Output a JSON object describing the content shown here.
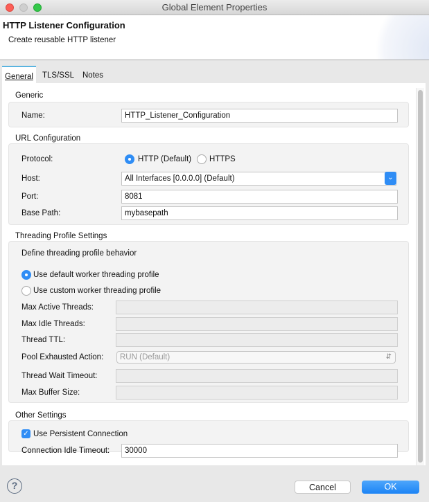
{
  "window": {
    "title": "Global Element Properties"
  },
  "header": {
    "title": "HTTP Listener Configuration",
    "subtitle": "Create reusable HTTP listener"
  },
  "tabs": [
    {
      "label": "General",
      "active": true
    },
    {
      "label": "TLS/SSL"
    },
    {
      "label": "Notes"
    }
  ],
  "generic": {
    "title": "Generic",
    "name_label": "Name:",
    "name_value": "HTTP_Listener_Configuration"
  },
  "url": {
    "title": "URL Configuration",
    "protocol_label": "Protocol:",
    "protocol_options": [
      "HTTP (Default)",
      "HTTPS"
    ],
    "protocol_selected": "HTTP (Default)",
    "host_label": "Host:",
    "host_value": "All Interfaces [0.0.0.0] (Default)",
    "port_label": "Port:",
    "port_value": "8081",
    "basepath_label": "Base Path:",
    "basepath_value": "mybasepath"
  },
  "threading": {
    "title": "Threading Profile Settings",
    "description": "Define threading profile behavior",
    "option_default": "Use default worker threading profile",
    "option_custom": "Use custom worker threading profile",
    "max_active_label": "Max Active Threads:",
    "max_idle_label": "Max Idle Threads:",
    "ttl_label": "Thread TTL:",
    "pool_label": "Pool Exhausted Action:",
    "pool_value": "RUN (Default)",
    "wait_label": "Thread Wait Timeout:",
    "buffer_label": "Max Buffer Size:"
  },
  "other": {
    "title": "Other Settings",
    "persistent_label": "Use Persistent Connection",
    "persistent_checked": true,
    "idle_label": "Connection Idle Timeout:",
    "idle_value": "30000"
  },
  "footer": {
    "cancel": "Cancel",
    "ok": "OK"
  },
  "colors": {
    "accent": "#2f8df5"
  }
}
